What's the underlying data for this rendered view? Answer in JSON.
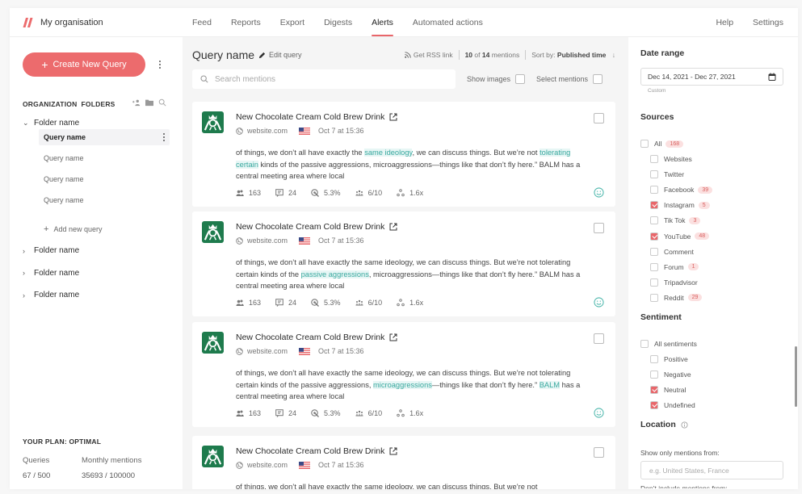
{
  "brand": {
    "org_name": "My organisation",
    "accent": "#ec6b6d",
    "highlight": "#3aa99f"
  },
  "nav": {
    "items": [
      {
        "label": "Feed",
        "active": false
      },
      {
        "label": "Reports",
        "active": false
      },
      {
        "label": "Export",
        "active": false
      },
      {
        "label": "Digests",
        "active": false
      },
      {
        "label": "Alerts",
        "active": true
      },
      {
        "label": "Automated actions",
        "active": false
      }
    ],
    "right": [
      {
        "label": "Help"
      },
      {
        "label": "Settings"
      }
    ]
  },
  "sidebar": {
    "create_label": "Create New Query",
    "folders_heading": "ORGANIZATION  FOLDERS",
    "icons": [
      "add-user-icon",
      "folder-icon",
      "search-icon"
    ],
    "open_folder": {
      "name": "Folder name",
      "queries": [
        {
          "name": "Query name",
          "active": true
        },
        {
          "name": "Query name",
          "active": false
        },
        {
          "name": "Query name",
          "active": false
        },
        {
          "name": "Query name",
          "active": false
        }
      ],
      "add_label": "Add new query"
    },
    "folders": [
      {
        "name": "Folder name"
      },
      {
        "name": "Folder name"
      },
      {
        "name": "Folder name"
      }
    ],
    "plan": {
      "title": "YOUR PLAN: OPTIMAL",
      "queries_label": "Queries",
      "queries_value": "67 / 500",
      "mentions_label": "Monthly mentions",
      "mentions_value": "35693 / 100000"
    }
  },
  "main": {
    "query_title": "Query name",
    "edit_label": "Edit query",
    "rss_label": "Get RSS link",
    "count_shown": "10",
    "count_of": "of",
    "count_total": "14",
    "count_suffix": "mentions",
    "sort_label": "Sort by:",
    "sort_value": "Published time",
    "search_placeholder": "Search mentions",
    "show_images_label": "Show images",
    "select_mentions_label": "Select mentions",
    "mentions": [
      {
        "title": "New Chocolate Cream Cold Brew Drink",
        "source": "website.com",
        "date": "Oct 7 at 15:36",
        "segments": [
          {
            "t": "of things, we don’t all have exactly the "
          },
          {
            "t": "same ideology",
            "hl": true
          },
          {
            "t": ", we can discuss things. But we’re not "
          },
          {
            "t": "tolerating certain",
            "hl": true
          },
          {
            "t": " kinds of the passive aggressions, microaggressions—things like that don’t fly here.” BALM has a central meeting area where local"
          }
        ],
        "stats": {
          "reach": "163",
          "comments": "24",
          "engagement": "5.3%",
          "influence": "6/10",
          "virality": "1.6x"
        }
      },
      {
        "title": "New Chocolate Cream Cold Brew Drink",
        "source": "website.com",
        "date": "Oct 7 at 15:36",
        "segments": [
          {
            "t": "of things, we don’t all have exactly the same ideology, we can discuss things. But we’re not tolerating certain kinds of the "
          },
          {
            "t": "passive aggressions",
            "hl": true
          },
          {
            "t": ", microaggressions—things like that don’t fly here.” BALM has a central meeting area where local"
          }
        ],
        "stats": {
          "reach": "163",
          "comments": "24",
          "engagement": "5.3%",
          "influence": "6/10",
          "virality": "1.6x"
        }
      },
      {
        "title": "New Chocolate Cream Cold Brew Drink",
        "source": "website.com",
        "date": "Oct 7 at 15:36",
        "segments": [
          {
            "t": "of things, we don’t all have exactly the same ideology, we can discuss things. But we’re not tolerating certain kinds of the passive aggressions, "
          },
          {
            "t": "microaggressions",
            "hl": true
          },
          {
            "t": "—things like that don’t fly here.” "
          },
          {
            "t": "BALM",
            "hl": true
          },
          {
            "t": " has a central meeting area where local"
          }
        ],
        "stats": {
          "reach": "163",
          "comments": "24",
          "engagement": "5.3%",
          "influence": "6/10",
          "virality": "1.6x"
        }
      },
      {
        "title": "New Chocolate Cream Cold Brew Drink",
        "source": "website.com",
        "date": "Oct 7 at 15:36",
        "segments": [
          {
            "t": "of things, we don’t all have exactly the same ideology, we can discuss things. But we’re not"
          }
        ],
        "stats": null
      }
    ]
  },
  "filters": {
    "date_range": {
      "title": "Date range",
      "value": "Dec 14, 2021 - Dec 27, 2021",
      "hint": "Custom"
    },
    "sources": {
      "title": "Sources",
      "all": {
        "label": "All",
        "count": "168",
        "checked": false
      },
      "items": [
        {
          "label": "Websites",
          "count": null,
          "checked": false
        },
        {
          "label": "Twitter",
          "count": null,
          "checked": false
        },
        {
          "label": "Facebook",
          "count": "39",
          "checked": false
        },
        {
          "label": "Instagram",
          "count": "5",
          "checked": true
        },
        {
          "label": "Tik Tok",
          "count": "3",
          "checked": false
        },
        {
          "label": "YouTube",
          "count": "48",
          "checked": true
        },
        {
          "label": "Comment",
          "count": null,
          "checked": false
        },
        {
          "label": "Forum",
          "count": "1",
          "checked": false
        },
        {
          "label": "Tripadvisor",
          "count": null,
          "checked": false
        },
        {
          "label": "Reddit",
          "count": "29",
          "checked": false
        }
      ]
    },
    "sentiment": {
      "title": "Sentiment",
      "all": {
        "label": "All sentiments",
        "checked": false
      },
      "items": [
        {
          "label": "Positive",
          "checked": false
        },
        {
          "label": "Negative",
          "checked": false
        },
        {
          "label": "Neutral",
          "checked": true
        },
        {
          "label": "Undefined",
          "checked": true
        }
      ]
    },
    "location": {
      "title": "Location",
      "only_label": "Show only mentions from:",
      "only_placeholder": "e.g. United States, France",
      "exclude_label": "Don’t include mentions from:"
    }
  }
}
